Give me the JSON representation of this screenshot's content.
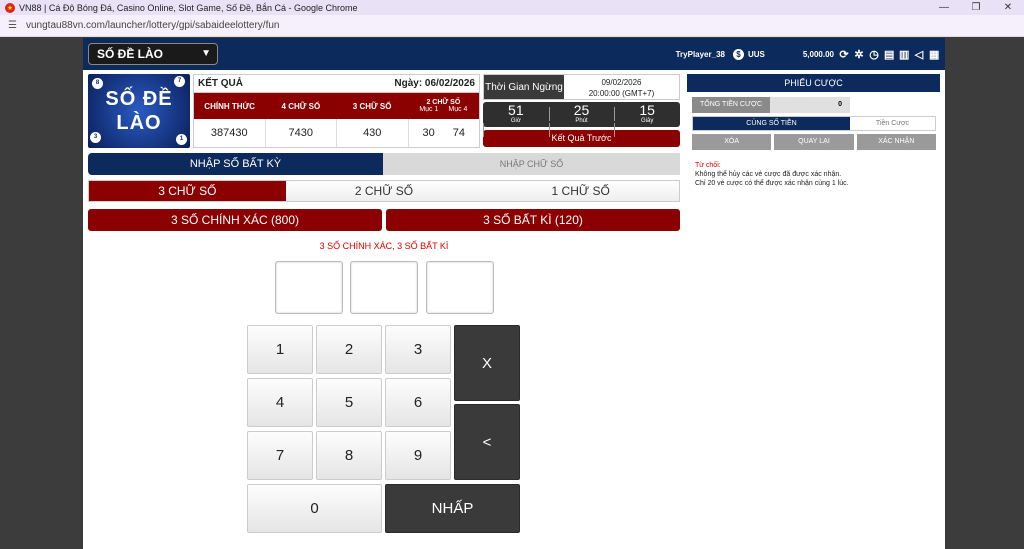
{
  "browser": {
    "title": "VN88 | Cá Độ Bóng Đá, Casino Online, Slot Game, Số Đề, Bắn Cá - Google Chrome",
    "url": "vungtau88vn.com/launcher/lottery/gpi/sabaideelottery/fun",
    "controls": {
      "minimize": "—",
      "restore": "❐",
      "close": "✕"
    }
  },
  "topnav": {
    "game_select": "SỐ ĐỀ LÀO",
    "player": "TryPlayer_38",
    "currency": "UUS",
    "balance": "5,000.00"
  },
  "logo": {
    "line1": "SỐ ĐỀ",
    "line2": "LÀO",
    "balls": [
      "8",
      "7",
      "3",
      "1"
    ]
  },
  "results": {
    "label": "KẾT QUẢ",
    "date": "Ngày: 06/02/2026",
    "headers": {
      "main": "CHÍNH THỨC",
      "four": "4 CHỮ SỐ",
      "three": "3 CHỮ SỐ",
      "two": "2 CHỮ SỐ",
      "muc1": "Mục 1",
      "muc4": "Mục 4"
    },
    "values": {
      "main": "387430",
      "four": "7430",
      "three": "430",
      "muc1": "30",
      "muc4": "74"
    }
  },
  "countdown": {
    "label": "Thời Gian Ngừng",
    "date": "09/02/2026",
    "time": "20:00:00 (GMT+7)",
    "hours": "51",
    "hours_unit": "Giờ",
    "minutes": "25",
    "minutes_unit": "Phút",
    "seconds": "15",
    "seconds_unit": "Giây",
    "prev_button": "Kết Quả Trước"
  },
  "mode_tabs": {
    "active": "NHẬP SỐ BẤT KỲ",
    "inactive": "NHẬP CHỮ SỐ"
  },
  "digit_tabs": [
    "3 CHỮ SỐ",
    "2 CHỮ SỐ",
    "1 CHỮ SỐ"
  ],
  "bet_types": [
    "3 SỐ CHÍNH XÁC (800)",
    "3 SỐ BẤT KÌ (120)"
  ],
  "hint": "3 SỐ CHÍNH XÁC, 3 SỐ BẤT KÌ",
  "keypad": {
    "k1": "1",
    "k2": "2",
    "k3": "3",
    "k4": "4",
    "k5": "5",
    "k6": "6",
    "k7": "7",
    "k8": "8",
    "k9": "9",
    "k0": "0",
    "clear": "X",
    "back": "<",
    "enter": "NHẤP"
  },
  "slip": {
    "title": "PHIẾU CƯỢC",
    "total_label": "TỔNG TIỀN CƯỢC",
    "total_value": "0",
    "same_amount": "CÙNG SỐ TIỀN",
    "amount_placeholder": "Tiền Cược",
    "delete": "XÓA",
    "back": "QUAY LẠI",
    "confirm": "XÁC NHẬN",
    "note_title": "Từ chối:",
    "note_line1": "Không thể hủy các vé cược đã được xác nhận.",
    "note_line2": "Chỉ 20 vé cược có thể được xác nhận cùng 1 lúc."
  }
}
